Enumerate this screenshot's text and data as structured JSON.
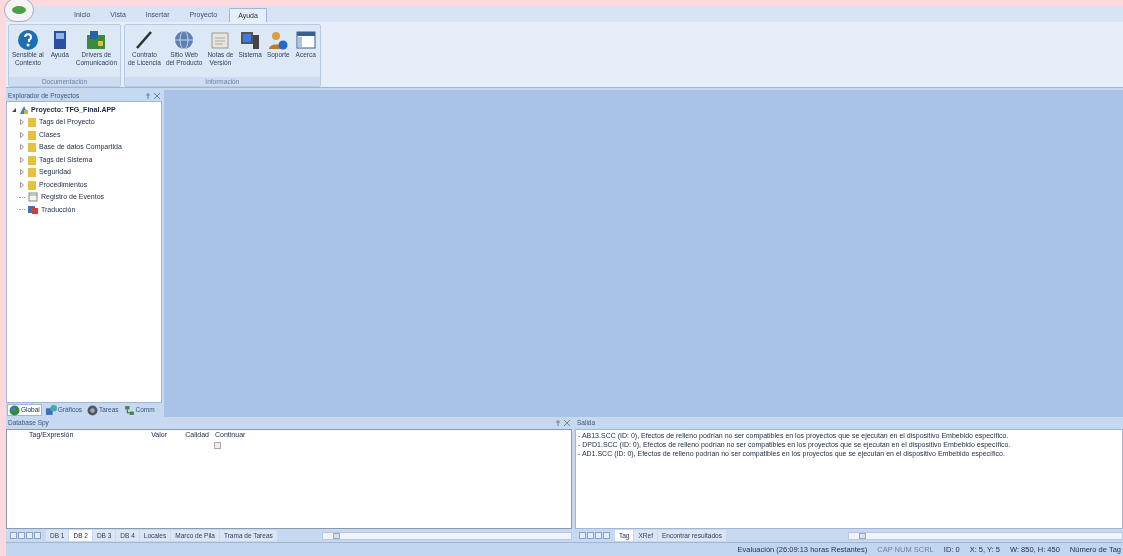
{
  "ribbon": {
    "tabs": [
      {
        "label": "Inicio",
        "selected": false
      },
      {
        "label": "Vista",
        "selected": false
      },
      {
        "label": "Insertar",
        "selected": false
      },
      {
        "label": "Proyecto",
        "selected": false
      },
      {
        "label": "Ayuda",
        "selected": true
      }
    ],
    "groups": [
      {
        "title": "Documentación",
        "buttons": [
          {
            "kind": "help",
            "lines": [
              "Sensible al",
              "Contexto"
            ]
          },
          {
            "kind": "book",
            "lines": [
              "Ayuda"
            ]
          },
          {
            "kind": "drivers",
            "lines": [
              "Drivers de",
              "Comunicación"
            ]
          }
        ]
      },
      {
        "title": "Información",
        "buttons": [
          {
            "kind": "pen",
            "lines": [
              "Contrato",
              "de Licencia"
            ]
          },
          {
            "kind": "globe",
            "lines": [
              "Sitio Web",
              "del Producto"
            ]
          },
          {
            "kind": "notes",
            "lines": [
              "Notas de",
              "Versión"
            ]
          },
          {
            "kind": "system",
            "lines": [
              "Sistema"
            ]
          },
          {
            "kind": "support",
            "lines": [
              "Soporte"
            ]
          },
          {
            "kind": "about",
            "lines": [
              "Acerca"
            ]
          }
        ]
      }
    ]
  },
  "explorer": {
    "title": "Explorador de Proyectos",
    "tree": {
      "label": "Proyecto: TFG_Final.APP",
      "kind": "project",
      "expanded": true,
      "children": [
        {
          "label": "Tags del Proyecto",
          "kind": "folder",
          "expanded": false
        },
        {
          "label": "Clases",
          "kind": "folder",
          "expanded": false
        },
        {
          "label": "Base de datos Compartida",
          "kind": "folder",
          "expanded": false
        },
        {
          "label": "Tags del Sistema",
          "kind": "folder",
          "expanded": false
        },
        {
          "label": "Seguridad",
          "kind": "folder",
          "expanded": false
        },
        {
          "label": "Procedimientos",
          "kind": "folder",
          "expanded": false
        },
        {
          "label": "Registro de Eventos",
          "kind": "log"
        },
        {
          "label": "Traducción",
          "kind": "translate"
        }
      ]
    },
    "tabs": [
      {
        "label": "Global",
        "kind": "globe",
        "selected": true
      },
      {
        "label": "Gráficos",
        "kind": "graphics",
        "selected": false
      },
      {
        "label": "Tareas",
        "kind": "tasks",
        "selected": false
      },
      {
        "label": "Comm",
        "kind": "comm",
        "selected": false
      }
    ]
  },
  "database_spy": {
    "title": "Database Spy",
    "columns": [
      "Tag/Expresión",
      "Valor",
      "Calidad",
      "Continuar"
    ],
    "rows": [
      {
        "continue_checked": false
      }
    ],
    "sheet_tabs": [
      {
        "label": "DB 1",
        "selected": false
      },
      {
        "label": "DB 2",
        "selected": true
      },
      {
        "label": "DB 3",
        "selected": false
      },
      {
        "label": "DB 4",
        "selected": false
      },
      {
        "label": "Locales",
        "selected": false
      },
      {
        "label": "Marco de Pila",
        "selected": false
      },
      {
        "label": "Trama de Tareas",
        "selected": false
      }
    ]
  },
  "output": {
    "title": "Salida",
    "lines": [
      "- AB13.SCC (ID: 0), Efectos de relleno podrían no ser compatibles en los proyectos que se ejecutan en el dispositivo Embebido específico.",
      "- DPD1.SCC (ID: 0), Efectos de relleno podrían no ser compatibles en los proyectos que se ejecutan en el dispositivo Embebido específico.",
      "- AD1.SCC (ID: 0), Efectos de relleno podrían no ser compatibles en los proyectos que se ejecutan en el dispositivo Embebido específico."
    ],
    "tabs": [
      {
        "label": "Tag",
        "selected": true
      },
      {
        "label": "XRef",
        "selected": false
      },
      {
        "label": "Encontrar resultados",
        "selected": false
      }
    ]
  },
  "status_bar": [
    {
      "text": "Evaluación (26:09:13 horas Restantes)",
      "disabled": false
    },
    {
      "text": "CAP NUM SCRL",
      "disabled": true
    },
    {
      "text": "ID: 0",
      "disabled": false
    },
    {
      "text": "X: 5, Y: 5",
      "disabled": false
    },
    {
      "text": "W: 850, H: 450",
      "disabled": false
    },
    {
      "text": "Número de Tag",
      "disabled": false
    }
  ]
}
